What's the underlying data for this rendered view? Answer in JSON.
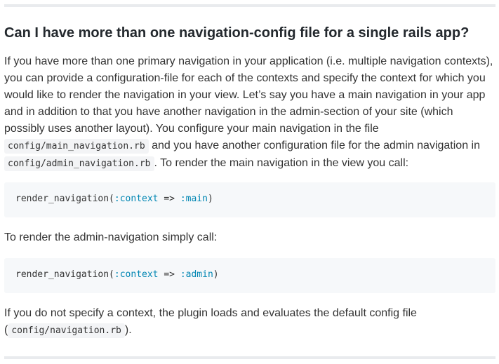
{
  "heading": "Can I have more than one navigation-config file for a single rails app?",
  "intro": {
    "text_before_code1": "If you have more than one primary navigation in your application (i.e. multiple navigation contexts), you can provide a configuration-file for each of the contexts and specify the context for which you would like to render the navigation in your view. Let’s say you have a main navigation in your app and in addition to that you have another navigation in the admin-section of your site (which possibly uses another layout). You configure your main navigation in the file ",
    "code1": "config/main_navigation.rb",
    "text_between": " and you have another configuration file for the admin navigation in ",
    "code2": "config/admin_navigation.rb",
    "text_after": ". To render the main navigation in the view you call:"
  },
  "code_block_main": {
    "method": "render_navigation(",
    "key": ":context",
    "arrow": " => ",
    "value": ":main",
    "close": ")"
  },
  "admin_intro": "To render the admin-navigation simply call:",
  "code_block_admin": {
    "method": "render_navigation(",
    "key": ":context",
    "arrow": " => ",
    "value": ":admin",
    "close": ")"
  },
  "closing": {
    "text_before": "If you do not specify a context, the plugin loads and evaluates the default config file (",
    "code": "config/navigation.rb",
    "text_after": ")."
  },
  "colors": {
    "symbol": "#0086b3",
    "code_background": "#f6f8fa",
    "rule": "#e9ebee"
  }
}
